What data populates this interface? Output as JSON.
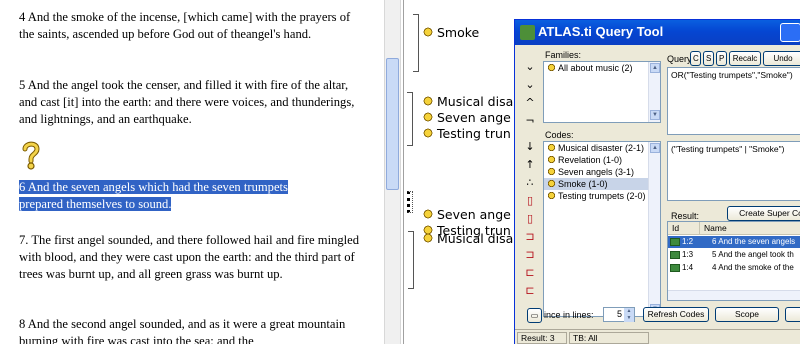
{
  "document": {
    "paragraphs": [
      "4  And the smoke of the incense, [which came] with the prayers of the saints, ascended up before God out of theangel's hand.",
      "5  And the angel took the censer, and filled it with fire of the altar, and cast [it] into the earth: and there were voices, and thunderings, and lightnings, and an earthquake.",
      "6  And the seven angels which had the seven trumpets prepared themselves to sound.",
      "7. The first angel sounded, and there followed hail and fire mingled with blood, and they were cast upon the earth: and the third part of trees was burnt up, and all green grass was burnt up.",
      "8  And the second angel sounded, and as it were a great mountain burning with fire was cast into the sea: and the"
    ],
    "selected_line_1": "6  And the seven angels which had the seven trumpets",
    "selected_line_2": "prepared themselves to sound.",
    "question_icon": "question-mark-icon"
  },
  "margin": {
    "codes": [
      "Smoke",
      "Musical disa",
      "Seven ange",
      "Testing trun",
      "Seven ange",
      "Testing trun",
      "Musical disa"
    ],
    "code_icon": "code-icon"
  },
  "query_tool": {
    "title": "ATLAS.ti Query Tool",
    "families_label": "Families:",
    "families": [
      "All about music (2)"
    ],
    "codes_label": "Codes:",
    "codes": [
      "Musical disaster (2-1)",
      "Revelation (1-0)",
      "Seven angels (3-1)",
      "Smoke (1-0)",
      "Testing trumpets (2-0)"
    ],
    "selected_code": "Smoke (1-0)",
    "query_label": "Query:",
    "query_buttons": [
      "C",
      "S",
      "P",
      "Recalc",
      "Undo"
    ],
    "query_text": "OR(\"Testing trumpets\",\"Smoke\")",
    "query_text_2": "(\"Testing trumpets\" | \"Smoke\")",
    "result_label": "Result:",
    "create_super_code_button": "Create Super Co",
    "columns": [
      "Id",
      "Name"
    ],
    "results": [
      {
        "id": "1:2",
        "name": "6 And the seven angels"
      },
      {
        "id": "1:3",
        "name": "5 And the angel took th"
      },
      {
        "id": "1:4",
        "name": "4 And the smoke of the"
      }
    ],
    "selected_result": "1:2",
    "lines_label": "ince in lines:",
    "lines_value": "5",
    "refresh_button": "Refresh Codes",
    "scope_button": "Scope",
    "status_result": "Result: 3",
    "status_tb": "TB: All",
    "title_icon": "atlas-ti-icon"
  }
}
